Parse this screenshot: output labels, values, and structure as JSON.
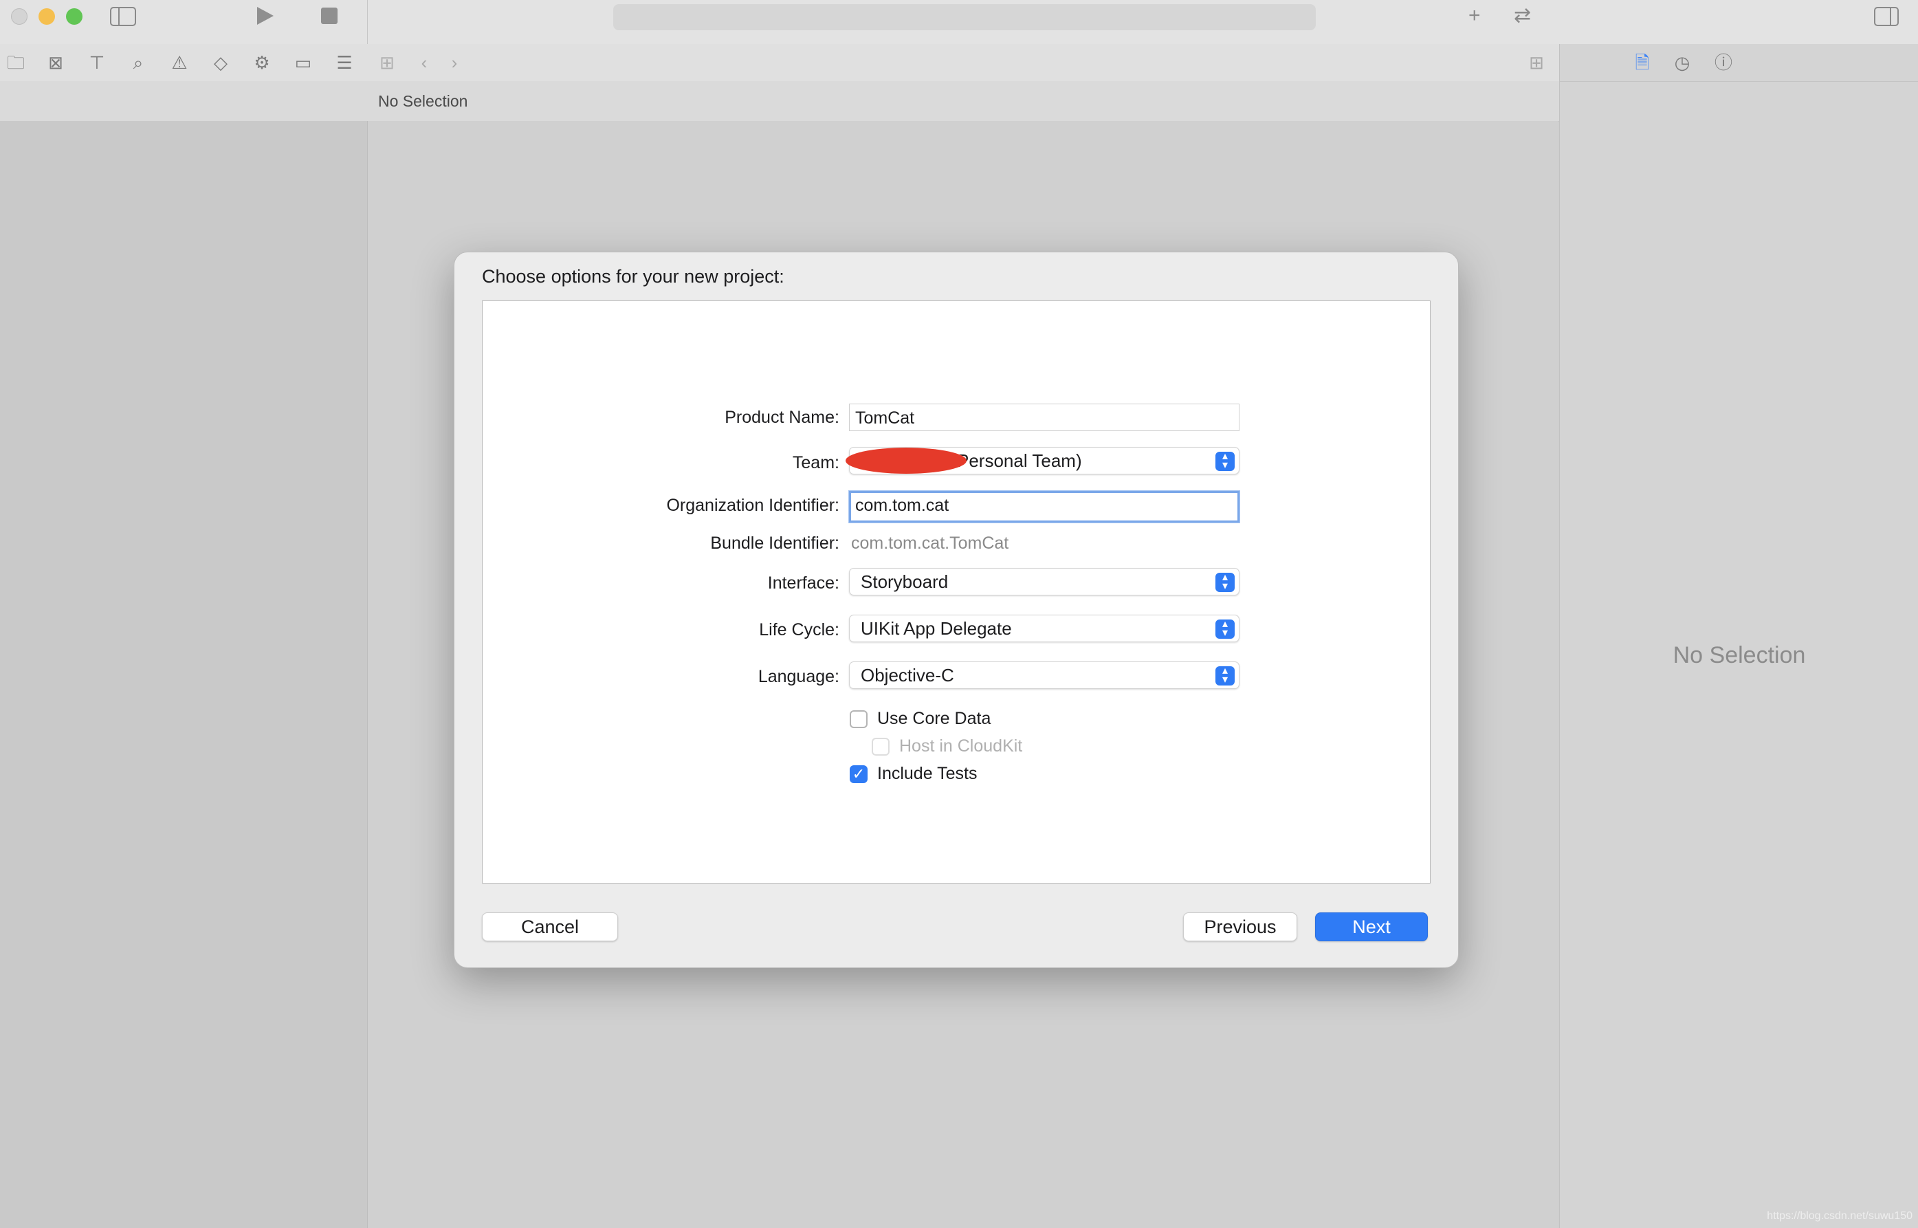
{
  "window": {
    "jump_bar_text": "No Selection",
    "inspector_placeholder": "No Selection",
    "icons": {
      "toolbar": [
        "sidebar-toggle-icon",
        "run-icon",
        "stop-icon",
        "add-icon",
        "code-review-icon",
        "inspector-toggle-icon"
      ],
      "navigator": [
        "folder-icon",
        "source-control-icon",
        "hierarchy-icon",
        "search-icon",
        "warning-icon",
        "test-icon",
        "debug-icon",
        "breakpoint-icon",
        "report-icon"
      ],
      "inspector": [
        "file-inspector-icon",
        "history-icon",
        "help-icon"
      ]
    }
  },
  "dialog": {
    "title": "Choose options for your new project:",
    "fields": {
      "product_name": {
        "label": "Product Name:",
        "value": "TomCat"
      },
      "team": {
        "label": "Team:",
        "value": "Personal Team)"
      },
      "organization_identifier": {
        "label": "Organization Identifier:",
        "value": "com.tom.cat"
      },
      "bundle_identifier": {
        "label": "Bundle Identifier:",
        "value": "com.tom.cat.TomCat"
      },
      "interface": {
        "label": "Interface:",
        "value": "Storyboard"
      },
      "life_cycle": {
        "label": "Life Cycle:",
        "value": "UIKit App Delegate"
      },
      "language": {
        "label": "Language:",
        "value": "Objective-C"
      }
    },
    "options": {
      "use_core_data": {
        "label": "Use Core Data",
        "checked": false
      },
      "host_in_cloudkit": {
        "label": "Host in CloudKit",
        "checked": false,
        "enabled": false
      },
      "include_tests": {
        "label": "Include Tests",
        "checked": true
      }
    },
    "buttons": {
      "cancel": "Cancel",
      "previous": "Previous",
      "next": "Next"
    }
  },
  "watermark": "https://blog.csdn.net/suwu150"
}
